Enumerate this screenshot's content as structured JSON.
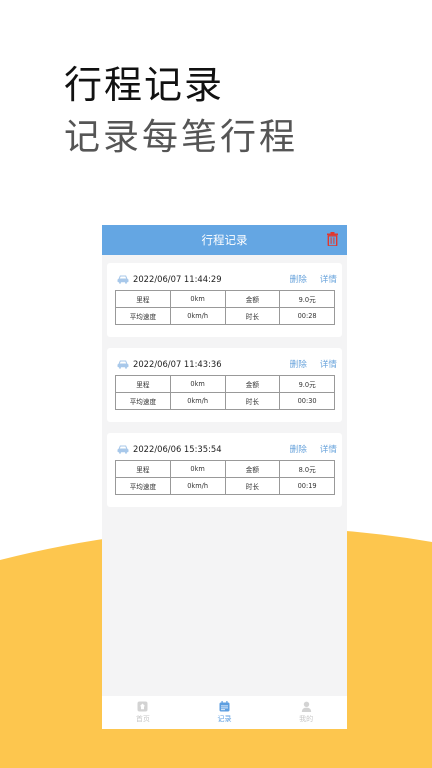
{
  "promo": {
    "title": "行程记录",
    "subtitle": "记录每笔行程"
  },
  "colors": {
    "accent": "#64a6e3",
    "link": "#6aa4dc",
    "delete_icon": "#e0382f",
    "wave": "#fdc64e"
  },
  "app": {
    "title": "行程记录",
    "header_action_icon": "trash-icon"
  },
  "records": [
    {
      "time": "2022/06/07 11:44:29",
      "delete_label": "删除",
      "detail_label": "详情",
      "rows": [
        [
          "里程",
          "0km",
          "金额",
          "9.0元"
        ],
        [
          "平均速度",
          "0km/h",
          "时长",
          "00:28"
        ]
      ]
    },
    {
      "time": "2022/06/07 11:43:36",
      "delete_label": "删除",
      "detail_label": "详情",
      "rows": [
        [
          "里程",
          "0km",
          "金额",
          "9.0元"
        ],
        [
          "平均速度",
          "0km/h",
          "时长",
          "00:30"
        ]
      ]
    },
    {
      "time": "2022/06/06 15:35:54",
      "delete_label": "删除",
      "detail_label": "详情",
      "rows": [
        [
          "里程",
          "0km",
          "金额",
          "8.0元"
        ],
        [
          "平均速度",
          "0km/h",
          "时长",
          "00:19"
        ]
      ]
    }
  ],
  "tabs": [
    {
      "label": "首页",
      "icon": "home-icon",
      "active": false
    },
    {
      "label": "记录",
      "icon": "calendar-icon",
      "active": true
    },
    {
      "label": "我的",
      "icon": "user-icon",
      "active": false
    }
  ]
}
